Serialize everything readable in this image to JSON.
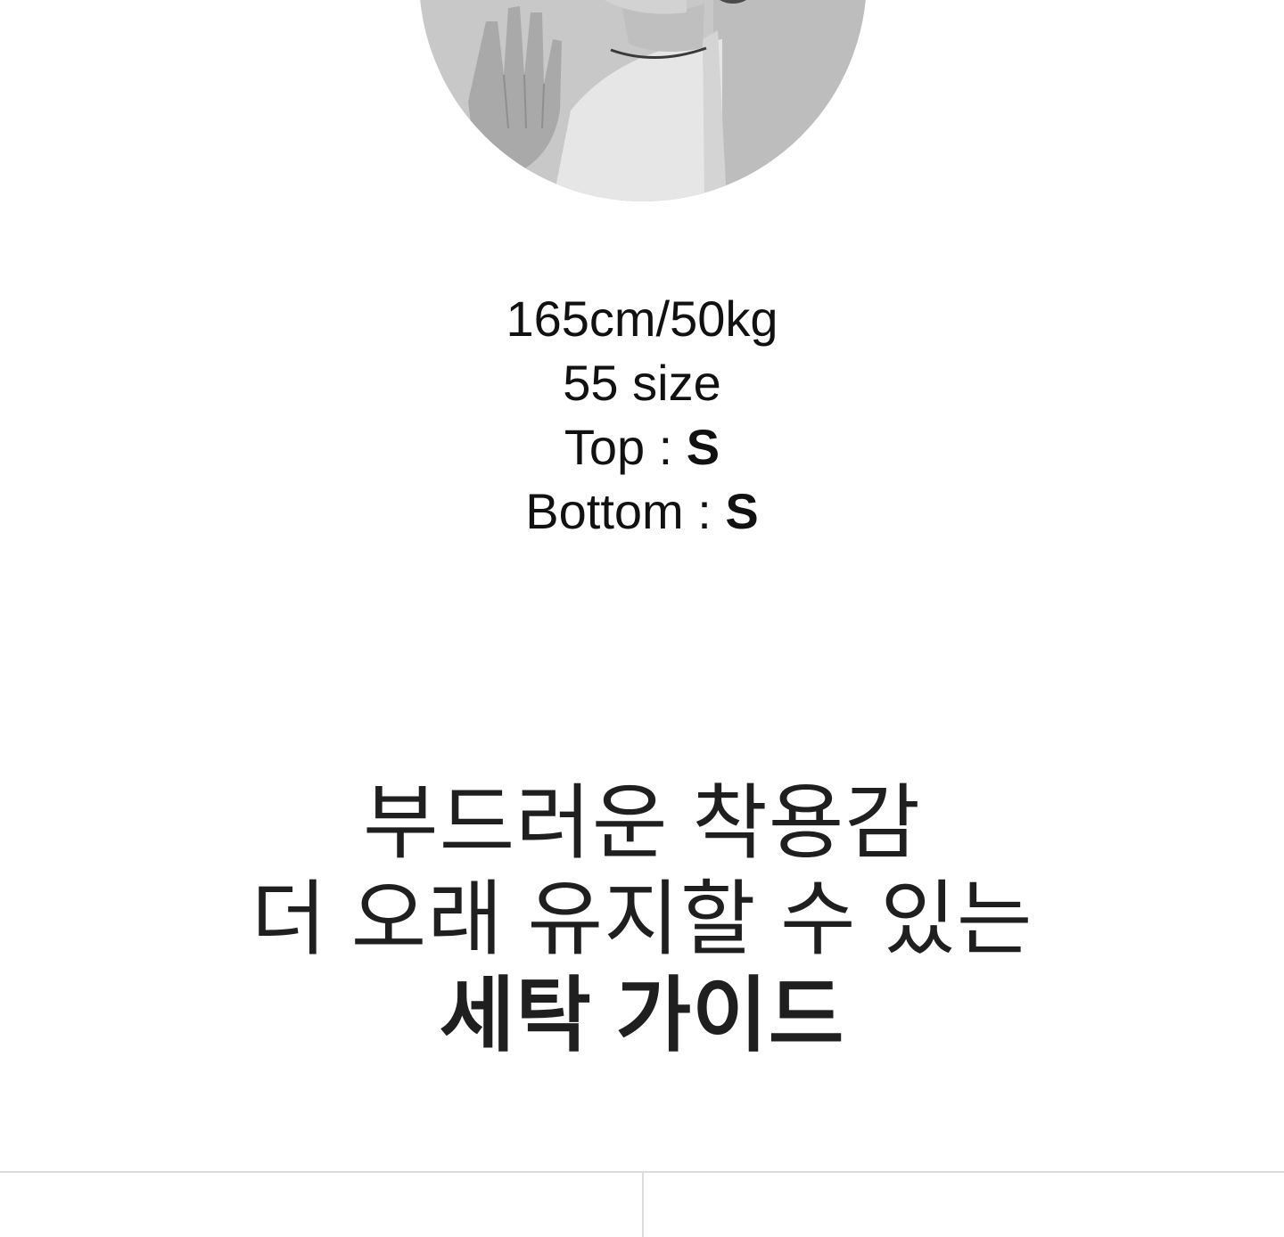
{
  "model": {
    "height_weight": "165cm/50kg",
    "size": "55 size",
    "top_label": "Top : ",
    "top_value": "S",
    "bottom_label": "Bottom : ",
    "bottom_value": "S"
  },
  "guide": {
    "line1": "부드러운 착용감",
    "line2": "더 오래 유지할 수 있는",
    "line3": "세탁 가이드"
  },
  "colors": {
    "text": "#111111",
    "headline": "#1f1f1f",
    "divider": "#dcdcdc",
    "photo_bg": "#c9c9c9"
  }
}
